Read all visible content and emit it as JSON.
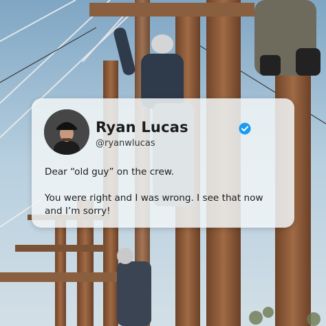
{
  "post": {
    "author_name": "Ryan Lucas",
    "handle": "@ryanwlucas",
    "verified_icon": "verified-badge-icon",
    "line1": "Dear “old guy” on the crew.",
    "line2": "You were right and I was wrong. I see that now and I’m sorry!"
  },
  "colors": {
    "sky": "#a9c4d6",
    "pole": "#8b5a3c",
    "card_bg": "#f0f4f6",
    "verified": "#1d9bf0",
    "text": "#1b1b1b"
  }
}
